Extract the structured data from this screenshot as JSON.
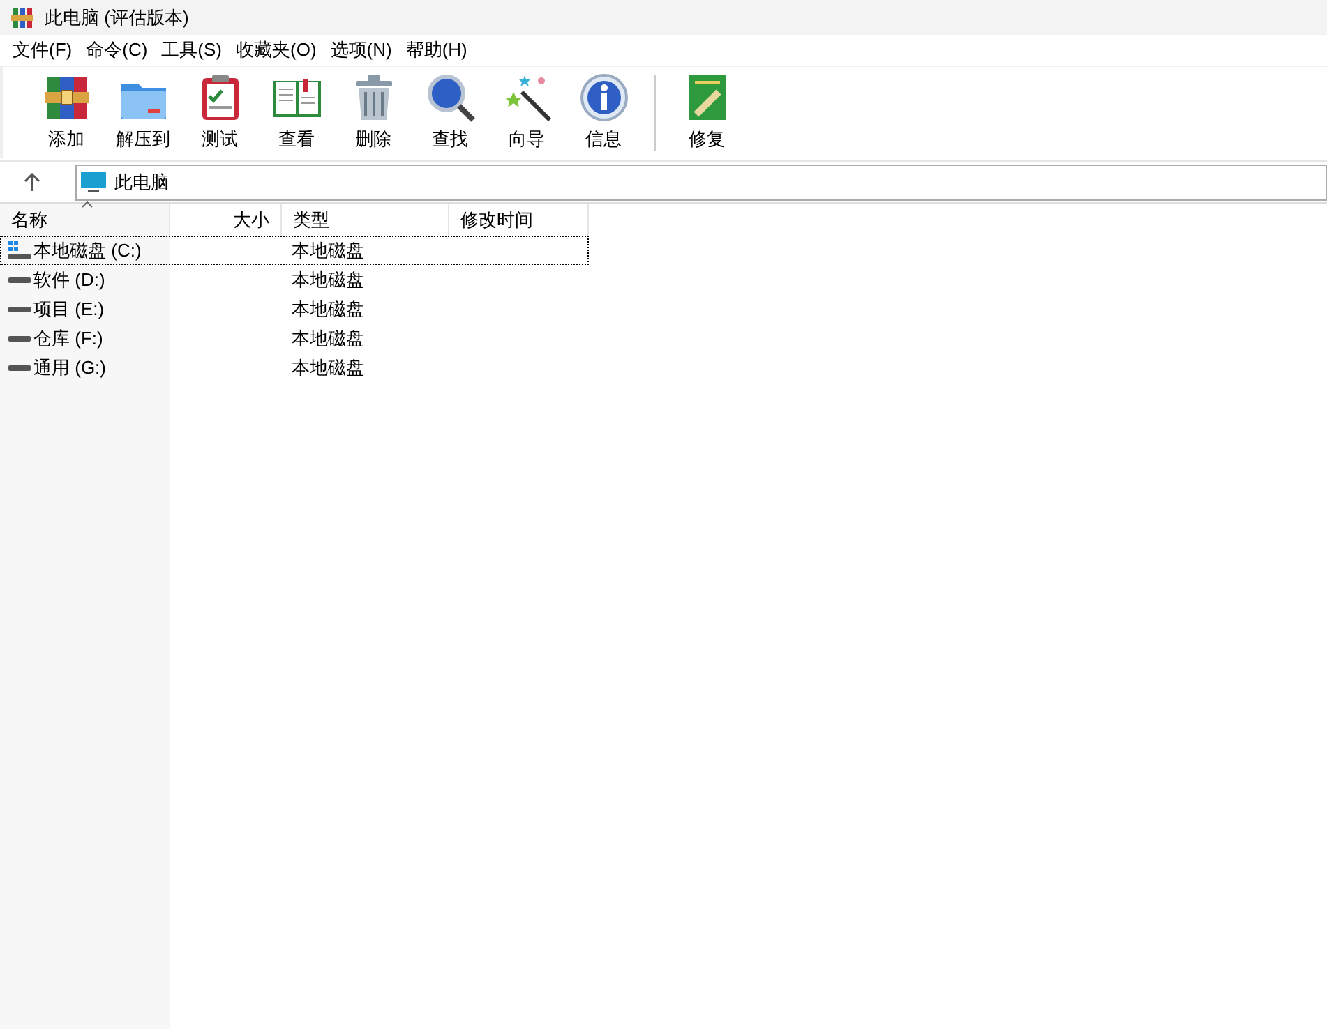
{
  "window": {
    "title": "此电脑 (评估版本)"
  },
  "menu": [
    "文件(F)",
    "命令(C)",
    "工具(S)",
    "收藏夹(O)",
    "选项(N)",
    "帮助(H)"
  ],
  "toolbar": [
    {
      "kind": "add",
      "label": "添加"
    },
    {
      "kind": "extract",
      "label": "解压到"
    },
    {
      "kind": "test",
      "label": "测试"
    },
    {
      "kind": "view",
      "label": "查看"
    },
    {
      "kind": "delete",
      "label": "删除"
    },
    {
      "kind": "find",
      "label": "查找"
    },
    {
      "kind": "wizard",
      "label": "向导"
    },
    {
      "kind": "info",
      "label": "信息"
    },
    {
      "kind": "repair",
      "label": "修复"
    }
  ],
  "address": {
    "path": "此电脑"
  },
  "table": {
    "columns": [
      "名称",
      "大小",
      "类型",
      "修改时间"
    ],
    "rows": [
      {
        "kind": "system",
        "name": "本地磁盘 (C:)",
        "type": "本地磁盘",
        "focused": true
      },
      {
        "kind": "drive",
        "name": "软件 (D:)",
        "type": "本地磁盘",
        "focused": false
      },
      {
        "kind": "drive",
        "name": "项目 (E:)",
        "type": "本地磁盘",
        "focused": false
      },
      {
        "kind": "drive",
        "name": "仓库 (F:)",
        "type": "本地磁盘",
        "focused": false
      },
      {
        "kind": "drive",
        "name": "通用 (G:)",
        "type": "本地磁盘",
        "focused": false
      }
    ]
  }
}
